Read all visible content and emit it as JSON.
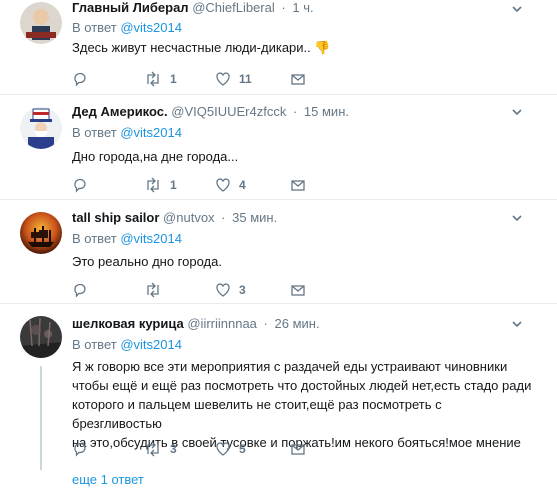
{
  "tweets": [
    {
      "name": "Главный Либерал",
      "handle": "@ChiefLiberal",
      "time": "1 ч.",
      "reply_prefix": "В ответ",
      "reply_to": "@vits2014",
      "text": "Здесь живут несчастные люди-дикари..",
      "emoji": "👎",
      "retweets": "1",
      "likes": "11",
      "replies": ""
    },
    {
      "name": "Дед Америкос.",
      "handle": "@VIQ5IUUEr4zfcck",
      "time": "15 мин.",
      "reply_prefix": "В ответ",
      "reply_to": "@vits2014",
      "text": "Дно города,на дне города...",
      "retweets": "1",
      "likes": "4",
      "replies": ""
    },
    {
      "name": "tall ship sailor",
      "handle": "@nutvox",
      "time": "35 мин.",
      "reply_prefix": "В ответ",
      "reply_to": "@vits2014",
      "text": "Это реально дно города.",
      "retweets": "",
      "likes": "3",
      "replies": ""
    },
    {
      "name": "шелковая курица",
      "handle": "@iirriinnnaa",
      "time": "26 мин.",
      "reply_prefix": "В ответ",
      "reply_to": "@vits2014",
      "text_lines": [
        "Я ж говорю все эти мероприятия с раздачей еды устраивают чиновники",
        "чтобы ещё и ещё раз посмотреть что достойных людей нет,есть стадо ради",
        "которого и пальцем шевелить не стоит,ещё раз посмотреть с брезгливостью",
        "на это,обсудить в своей тусовке и поржать!им некого бояться!мое мнение"
      ],
      "retweets": "3",
      "likes": "5",
      "replies": ""
    }
  ],
  "more_replies": "еще 1 ответ",
  "colors": {
    "link": "#1b95e0",
    "muted": "#657786",
    "divider": "#e6ecf0"
  }
}
